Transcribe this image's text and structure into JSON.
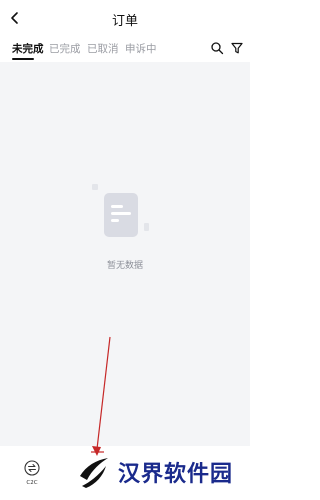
{
  "header": {
    "title": "订单"
  },
  "tabs": [
    {
      "label": "未完成",
      "active": true
    },
    {
      "label": "已完成",
      "active": false
    },
    {
      "label": "已取消",
      "active": false
    },
    {
      "label": "申诉中",
      "active": false
    }
  ],
  "toolbar": {
    "icons": [
      "search-icon",
      "filter-icon"
    ]
  },
  "empty_state": {
    "message": "暂无数据",
    "icon": "document-empty-icon"
  },
  "bottom_nav": {
    "c2c_label": "C2C",
    "c2c_icon": "c2c-icon"
  },
  "watermark": {
    "text": "汉界软件园"
  },
  "colors": {
    "accent": "#111111",
    "inactive_tab": "#9a9ca3",
    "background": "#f4f5f7",
    "arrow": "#c62828",
    "watermark": "#1a2a8c"
  }
}
